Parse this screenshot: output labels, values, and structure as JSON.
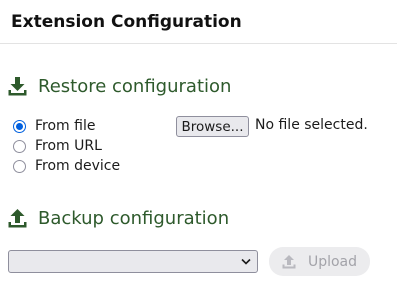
{
  "header": {
    "title": "Extension Configuration"
  },
  "restore": {
    "title": "Restore configuration",
    "icon": "download-icon",
    "options": [
      {
        "label": "From file",
        "checked": true
      },
      {
        "label": "From URL",
        "checked": false
      },
      {
        "label": "From device",
        "checked": false
      }
    ],
    "browse_label": "Browse...",
    "file_status": "No file selected."
  },
  "backup": {
    "title": "Backup configuration",
    "icon": "upload-icon",
    "select_value": "",
    "upload_label": "Upload",
    "upload_enabled": false
  },
  "colors": {
    "section_title": "#2e5a2c",
    "radio_checked": "#0060df",
    "disabled_text": "#a3a3a9"
  }
}
